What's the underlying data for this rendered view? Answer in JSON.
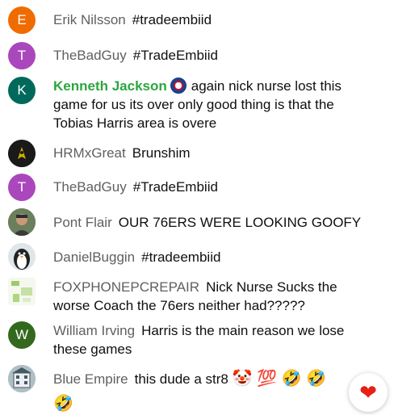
{
  "chat": {
    "messages": [
      {
        "author": "Erik Nilsson",
        "text": "#tradeembiid",
        "avatar_letter": "E",
        "avatar_color": "#ef6c00"
      },
      {
        "author": "TheBadGuy",
        "text": "#TradeEmbiid",
        "avatar_letter": "T",
        "avatar_color": "#ab47bc"
      },
      {
        "author": "Kenneth Jackson",
        "text": "again nick nurse lost this game for us its over only good thing is that the Tobias Harris area is overe",
        "avatar_letter": "K",
        "avatar_color": "#00695c",
        "author_color": "#2ba640",
        "badge_icon": "sixers-badge-icon"
      },
      {
        "author": "HRMxGreat",
        "text": "Brunshim",
        "avatar_icon": "rocket-avatar-icon",
        "avatar_color": "#1a1a1a"
      },
      {
        "author": "TheBadGuy",
        "text": "#TradeEmbiid",
        "avatar_letter": "T",
        "avatar_color": "#ab47bc"
      },
      {
        "author": "Pont Flair",
        "text": "OUR 76ERS WERE LOOKING GOOFY",
        "avatar_icon": "photo-avatar-icon",
        "avatar_color": "#8d6e4a"
      },
      {
        "author": "DanielBuggin",
        "text": "#tradeembiid",
        "avatar_icon": "penguin-avatar-icon",
        "avatar_color": "#cfd8dc"
      },
      {
        "author": "FOXPHONEPCREPAIR",
        "text": "Nick Nurse Sucks the worse Coach the 76ers neither had?????",
        "avatar_icon": "fox-avatar-icon",
        "avatar_color": "#f1f8e9"
      },
      {
        "author": "William Irving",
        "text": "Harris is the main reason we lose these games",
        "avatar_letter": "W",
        "avatar_color": "#33691e"
      },
      {
        "author": "Blue Empire",
        "text": "this dude a str8",
        "emojis": "🤡 💯 🤣 🤣 🤣",
        "avatar_icon": "building-avatar-icon",
        "avatar_color": "#90a4ae"
      }
    ],
    "heart_icon": "❤"
  }
}
